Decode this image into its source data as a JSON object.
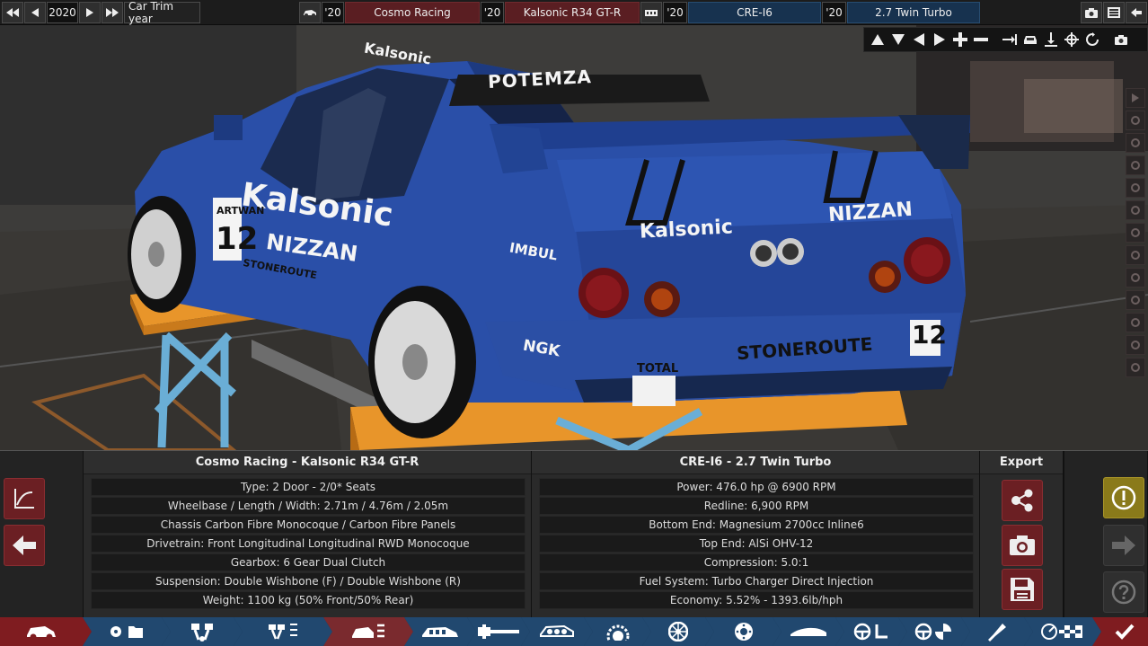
{
  "topbar": {
    "year": "2020",
    "car_trim_label": "Car Trim year",
    "car_year_short": "'20",
    "car_model": "Cosmo Racing",
    "trim_year_short": "'20",
    "trim_name": "Kalsonic R34 GT-R",
    "engine_year_short": "'20",
    "engine_family": "CRE-I6",
    "variant_year_short": "'20",
    "variant_name": "2.7 Twin Turbo"
  },
  "livery": {
    "windshield_banner": "POTEMZA",
    "roof_text": "Kalsonic",
    "side_text_1": "Kalsonic",
    "side_text_2": "NIZZAN",
    "side_text_3": "STONEROUTE",
    "race_number": "12",
    "rear_text_1": "Kalsonic",
    "rear_text_2": "NIZZAN",
    "rear_text_3": "STONEROUTE",
    "sponsor_imbul": "IMBUL",
    "sponsor_ngk": "NGK",
    "sponsor_total": "TOTAL",
    "sponsor_side_small": "ARTWAN"
  },
  "car_panel": {
    "title": "Cosmo Racing - Kalsonic R34 GT-R",
    "rows": [
      "Type: 2 Door - 2/0* Seats",
      "Wheelbase / Length / Width: 2.71m / 4.76m / 2.05m",
      "Chassis Carbon Fibre Monocoque / Carbon Fibre Panels",
      "Drivetrain: Front Longitudinal Longitudinal RWD Monocoque",
      "Gearbox: 6 Gear Dual Clutch",
      "Suspension: Double Wishbone (F) / Double Wishbone (R)",
      "Weight: 1100 kg (50% Front/50% Rear)"
    ]
  },
  "engine_panel": {
    "title": "CRE-I6 - 2.7 Twin Turbo",
    "rows": [
      "Power: 476.0 hp @ 6900 RPM",
      "Redline:  6,900 RPM",
      "Bottom End: Magnesium 2700cc Inline6",
      "Top End: AlSi OHV-12",
      "Compression: 5.0:1",
      "Fuel System: Turbo Charger Direct Injection",
      "Economy: 5.52% - 1393.6lb/hph"
    ]
  },
  "export_panel": {
    "title": "Export"
  },
  "colors": {
    "car_body": "#2a4fa8",
    "accent_red": "#7a2a2e",
    "nav_blue": "#21486f",
    "warning_gold": "#8a7a1a",
    "lift_orange": "#e8952a"
  }
}
